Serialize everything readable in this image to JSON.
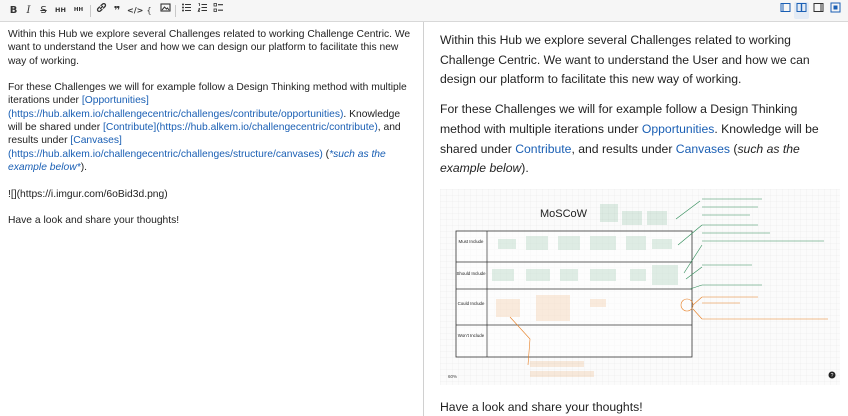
{
  "toolbar": {
    "buttons": [
      {
        "name": "bold-button",
        "label": "B"
      },
      {
        "name": "italic-button",
        "label": "I"
      },
      {
        "name": "strikethrough-button",
        "label": "S"
      },
      {
        "name": "heading-larger-button",
        "label": "HH"
      },
      {
        "name": "heading-smaller-button",
        "label": "HH"
      }
    ],
    "icons": [
      "link-icon",
      "quote-icon",
      "code-icon",
      "code-block-icon",
      "image-icon",
      "bullet-list-icon",
      "numbered-list-icon",
      "checklist-icon",
      "edit-only-icon",
      "split-view-icon",
      "preview-only-icon",
      "fullscreen-icon"
    ],
    "active_color": "#1a5fb4"
  },
  "editor": {
    "p1": "Within this Hub we explore several Challenges related to working Challenge Centric. We want to understand the User and how we can design our platform to facilitate this new way of working.",
    "p2_a": "For these Challenges we will for example follow a Design Thinking method with multiple iterations under ",
    "p2_link1": "[Opportunities](https://hub.alkem.io/challengecentric/challenges/contribute/opportunities)",
    "p2_b": ". Knowledge will be shared under ",
    "p2_link2": "[Contribute](https://hub.alkem.io/challengecentric/contribute)",
    "p2_c": ", and results under ",
    "p2_link3": "[Canvases](https://hub.alkem.io/challengecentric/challenges/structure/canvases)",
    "p2_d": " (",
    "p2_em": "*such as the example below*",
    "p2_e": ").",
    "p3": "![](https://i.imgur.com/6oBid3d.png)",
    "p4": "Have a look and share your thoughts!"
  },
  "preview": {
    "p1": "Within this Hub we explore several Challenges related to working Challenge Centric. We want to understand the User and how we can design our platform to facilitate this new way of working.",
    "p2_a": "For these Challenges we will for example follow a Design Thinking method with multiple iterations under ",
    "p2_link1": "Opportunities",
    "p2_b": ". Knowledge will be shared under ",
    "p2_link2": "Contribute",
    "p2_c": ", and results under ",
    "p2_link3": "Canvases",
    "p2_d": " (",
    "p2_em": "such as the example below",
    "p2_e": ").",
    "p4": "Have a look and share your thoughts!",
    "canvas": {
      "title": "MoSCoW",
      "rows": [
        "Must Include",
        "Should Include",
        "Could Include",
        "Won't Include"
      ],
      "footer_left": "60%",
      "help_icon": "?"
    }
  }
}
